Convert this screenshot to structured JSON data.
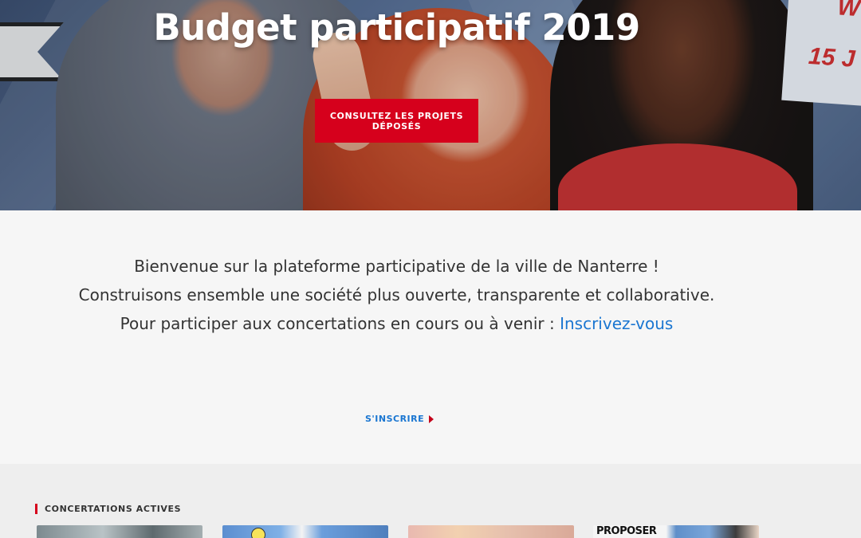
{
  "hero": {
    "title": "Budget participatif 2019",
    "cta_label": "CONSULTEZ LES PROJETS DÉPOSÉS",
    "side_text_1": "W",
    "side_text_2": "15 J"
  },
  "welcome": {
    "line1": "Bienvenue sur la plateforme participative de la ville de Nanterre !",
    "line2": "Construisons ensemble une société plus ouverte, transparente et collaborative.",
    "line3_prefix": "Pour participer aux concertations en cours ou à venir : ",
    "line3_link": "Inscrivez-vous",
    "signup_label": "S'INSCRIRE"
  },
  "concertations": {
    "title": "CONCERTATIONS ACTIVES",
    "cards": [
      {
        "image_label": ""
      },
      {
        "image_label": ""
      },
      {
        "image_label": ""
      },
      {
        "image_label": "PROPOSER"
      }
    ]
  },
  "colors": {
    "accent": "#d6001c",
    "link": "#1a76d1",
    "background": "#f6f6f6",
    "section_background": "#eeeeee"
  },
  "icons": {
    "signup_chevron": "chevron-right-icon"
  }
}
